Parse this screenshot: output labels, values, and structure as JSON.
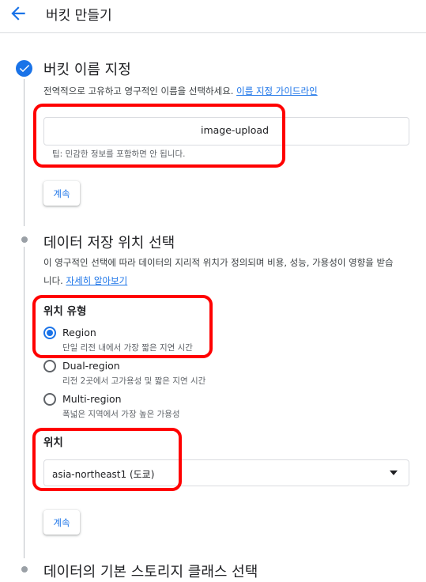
{
  "header": {
    "back_icon": "arrow-back-icon",
    "title": "버킷 만들기"
  },
  "step1": {
    "icon": "check-circle-icon",
    "title": "버킷 이름 지정",
    "description": "전역적으로 고유하고 영구적인 이름을 선택하세요.",
    "guide_link": "이름 지정 가이드라인",
    "input_value": "image-upload",
    "hint": "팁: 민감한 정보를 포함하면 안 됩니다.",
    "continue_label": "계속"
  },
  "step2": {
    "title": "데이터 저장 위치 선택",
    "description_line1": "이 영구적인 선택에 따라 데이터의 지리적 위치가 정의되며 비용, 성능, 가용성이 영향을 받습",
    "description_line2": "니다.",
    "learn_more_link": "자세히 알아보기",
    "location_type_label": "위치 유형",
    "options": [
      {
        "label": "Region",
        "sub": "단일 리전 내에서 가장 짧은 지연 시간",
        "selected": true
      },
      {
        "label": "Dual-region",
        "sub": "리전 2곳에서 고가용성 및 짧은 지연 시간",
        "selected": false
      },
      {
        "label": "Multi-region",
        "sub": "폭넓은 지역에서 가장 높은 가용성",
        "selected": false
      }
    ],
    "location_label": "위치",
    "location_value": "asia-northeast1 (도쿄)",
    "continue_label": "계속"
  },
  "step3": {
    "title": "데이터의 기본 스토리지 클래스 선택"
  },
  "colors": {
    "accent": "#1a73e8",
    "highlight": "#ff0000"
  }
}
